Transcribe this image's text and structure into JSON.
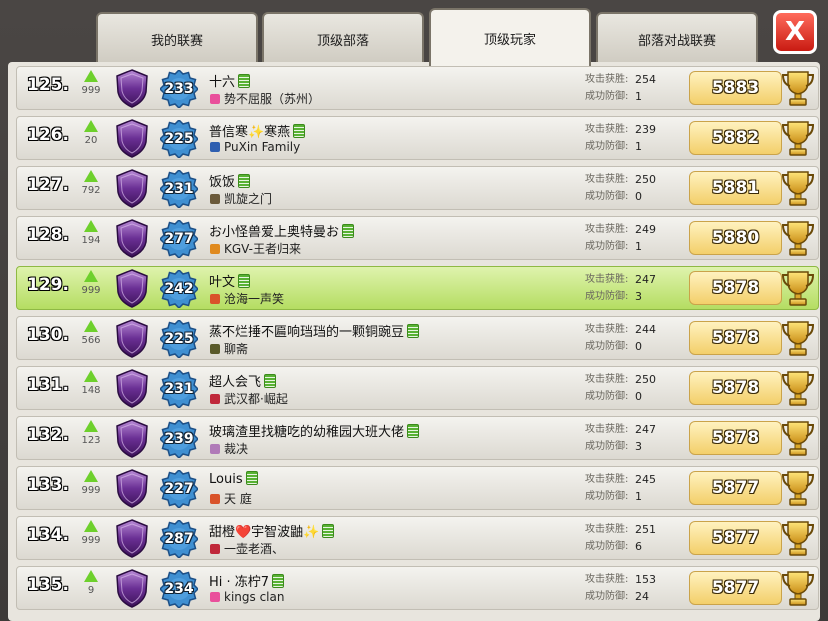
{
  "tabs": [
    {
      "label": "我的联赛",
      "active": false
    },
    {
      "label": "顶级部落",
      "active": false
    },
    {
      "label": "顶级玩家",
      "active": true
    },
    {
      "label": "部落对战联赛",
      "active": false
    }
  ],
  "close_label": "X",
  "stat_labels": {
    "attack_wins": "攻击获胜:",
    "defense_wins": "成功防御:"
  },
  "colors": {
    "highlight_row": "#c6e77b",
    "rank_up": "#6ed02c",
    "trophy_box": "#f6d77c"
  },
  "players": [
    {
      "rank": "125.",
      "delta": "999",
      "level": "233",
      "name": "十六",
      "clan": "势不屈服（苏州）",
      "badge_color": "#e94f9b",
      "attack_wins": "254",
      "defense_wins": "1",
      "trophies": "5883",
      "highlight": false
    },
    {
      "rank": "126.",
      "delta": "20",
      "level": "225",
      "name": "普信寒✨寒燕",
      "clan": "PuXin Family",
      "badge_color": "#2f5fb0",
      "attack_wins": "239",
      "defense_wins": "1",
      "trophies": "5882",
      "highlight": false
    },
    {
      "rank": "127.",
      "delta": "792",
      "level": "231",
      "name": "饭饭",
      "clan": "凯旋之门",
      "badge_color": "#6b5a3a",
      "attack_wins": "250",
      "defense_wins": "0",
      "trophies": "5881",
      "highlight": false
    },
    {
      "rank": "128.",
      "delta": "194",
      "level": "277",
      "name": "お小怪兽爱上奥特曼お",
      "clan": "KGV-王者归来",
      "badge_color": "#e08a1e",
      "attack_wins": "249",
      "defense_wins": "1",
      "trophies": "5880",
      "highlight": false
    },
    {
      "rank": "129.",
      "delta": "999",
      "level": "242",
      "name": "叶文",
      "clan": "沧海一声笑",
      "badge_color": "#d9532a",
      "attack_wins": "247",
      "defense_wins": "3",
      "trophies": "5878",
      "highlight": true
    },
    {
      "rank": "130.",
      "delta": "566",
      "level": "225",
      "name": "蒸不烂捶不匾响珰珰的一颗铜豌豆",
      "clan": "聊斋",
      "badge_color": "#5a5a2a",
      "attack_wins": "244",
      "defense_wins": "0",
      "trophies": "5878",
      "highlight": false
    },
    {
      "rank": "131.",
      "delta": "148",
      "level": "231",
      "name": "超人会飞",
      "clan": "武汉都·崛起",
      "badge_color": "#c0283a",
      "attack_wins": "250",
      "defense_wins": "0",
      "trophies": "5878",
      "highlight": false
    },
    {
      "rank": "132.",
      "delta": "123",
      "level": "239",
      "name": "玻璃渣里找糖吃的幼稚园大班大佬",
      "clan": "裁决",
      "badge_color": "#b07ab8",
      "attack_wins": "247",
      "defense_wins": "3",
      "trophies": "5878",
      "highlight": false
    },
    {
      "rank": "133.",
      "delta": "999",
      "level": "227",
      "name": "Louis",
      "clan": "天 庭",
      "badge_color": "#d9532a",
      "attack_wins": "245",
      "defense_wins": "1",
      "trophies": "5877",
      "highlight": false
    },
    {
      "rank": "134.",
      "delta": "999",
      "level": "287",
      "name": "甜橙❤️宇智波鼬✨",
      "clan": "一壶老酒、",
      "badge_color": "#c0283a",
      "attack_wins": "251",
      "defense_wins": "6",
      "trophies": "5877",
      "highlight": false
    },
    {
      "rank": "135.",
      "delta": "9",
      "level": "234",
      "name": "Hi · 冻柠7",
      "clan": "kings clan",
      "badge_color": "#e94f9b",
      "attack_wins": "153",
      "defense_wins": "24",
      "trophies": "5877",
      "highlight": false
    }
  ]
}
